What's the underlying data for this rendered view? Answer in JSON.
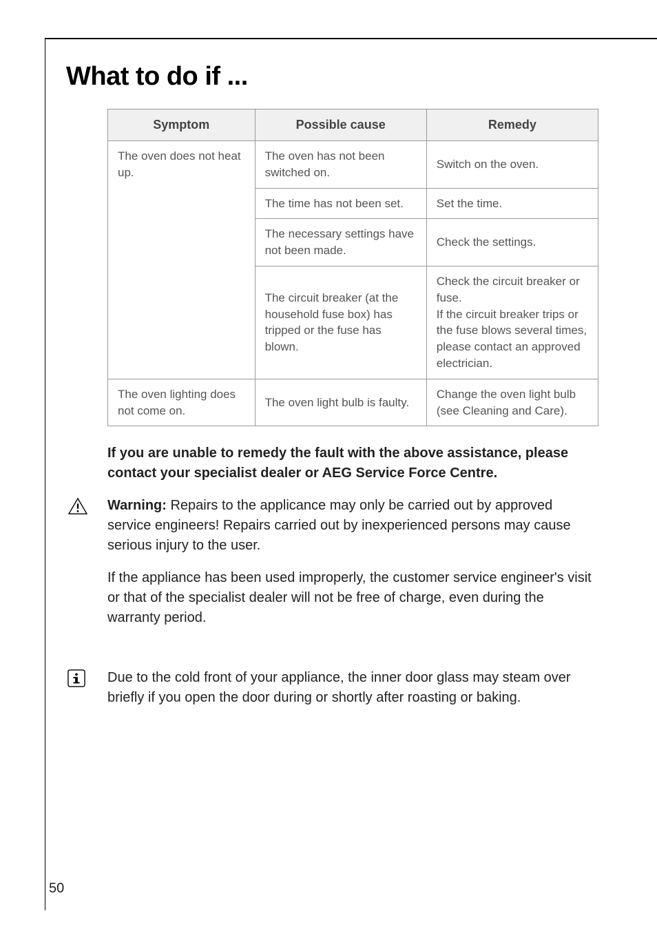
{
  "heading": "What to do if ...",
  "table": {
    "headers": {
      "symptom": "Symptom",
      "cause": "Possible cause",
      "remedy": "Remedy"
    },
    "rows": {
      "r1c1": "The oven does not heat up.",
      "r1c2": "The oven has not been switched on.",
      "r1c3": "Switch on the oven.",
      "r2c2": "The time has not been set.",
      "r2c3": "Set the time.",
      "r3c2": "The necessary settings have not been made.",
      "r3c3": "Check the settings.",
      "r4c2": "The circuit breaker (at the household fuse box) has tripped or the fuse has blown.",
      "r4c3": "Check the circuit breaker or fuse.\nIf the circuit breaker trips or the fuse blows several times, please contact an approved electrician.",
      "r5c1": "The oven lighting does not come on.",
      "r5c2": "The oven light bulb is faulty.",
      "r5c3": "Change the oven light bulb (see Cleaning and Care)."
    }
  },
  "paragraphs": {
    "p1": "If you are unable to remedy the fault with the above assistance, please contact your specialist dealer or AEG Service Force Centre.",
    "p2_bold": "Warning: ",
    "p2": "Repairs to the applicance may only be carried out by approved service engineers! Repairs carried out by inexperienced persons may cause serious injury to the user.",
    "p3": "If the appliance has been used improperly, the customer service engineer's visit or that of the specialist dealer will not be free of charge, even during the warranty period.",
    "p4": "Due to the cold front of your appliance, the inner door glass may steam over briefly if you open the door during or shortly after roasting or baking."
  },
  "page_number": "50"
}
